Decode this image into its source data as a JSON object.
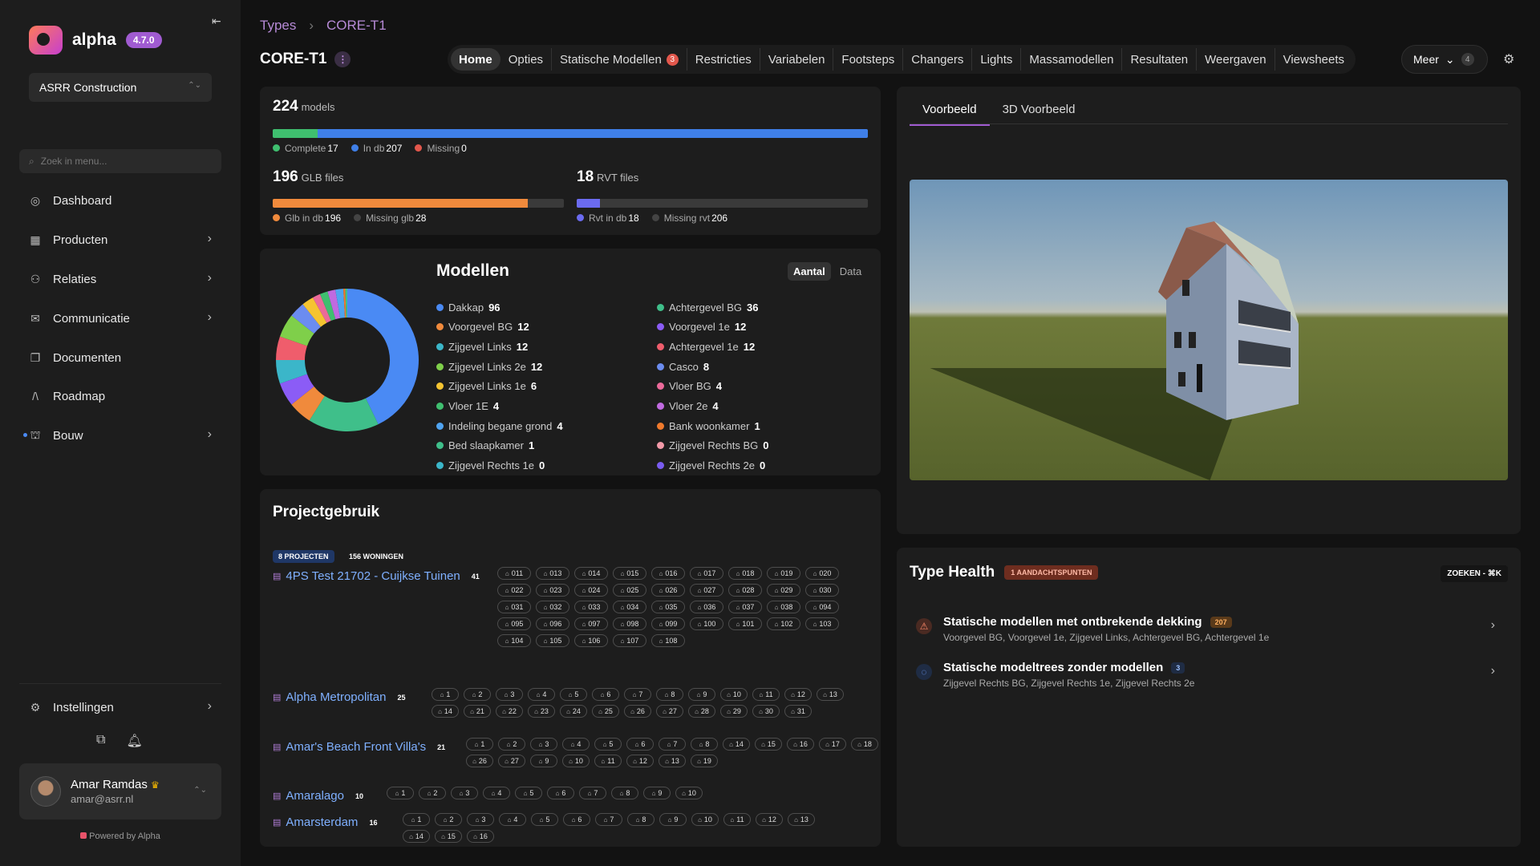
{
  "app": {
    "name": "alpha",
    "version": "4.7.0",
    "org": "ASRR Construction",
    "search_placeholder": "Zoek in menu...",
    "powered_by": "Powered by Alpha"
  },
  "nav": {
    "items": [
      {
        "label": "Dashboard",
        "icon": "dashboard-icon"
      },
      {
        "label": "Producten",
        "icon": "grid-icon"
      },
      {
        "label": "Relaties",
        "icon": "users-icon"
      },
      {
        "label": "Communicatie",
        "icon": "mail-icon"
      },
      {
        "label": "Documenten",
        "icon": "documents-icon"
      },
      {
        "label": "Roadmap",
        "icon": "roadmap-icon"
      },
      {
        "label": "Bouw",
        "icon": "crane-icon"
      }
    ],
    "settings": "Instellingen"
  },
  "user": {
    "name": "Amar Ramdas",
    "email": "amar@asrr.nl"
  },
  "breadcrumb": [
    "Types",
    "CORE-T1"
  ],
  "page_title": "CORE-T1",
  "tabs": [
    {
      "label": "Home",
      "active": true
    },
    {
      "label": "Opties"
    },
    {
      "label": "Statische Modellen",
      "badge": "3"
    },
    {
      "label": "Restricties"
    },
    {
      "label": "Variabelen"
    },
    {
      "label": "Footsteps"
    },
    {
      "label": "Changers"
    },
    {
      "label": "Lights"
    },
    {
      "label": "Massamodellen"
    },
    {
      "label": "Resultaten"
    },
    {
      "label": "Weergaven"
    },
    {
      "label": "Viewsheets"
    }
  ],
  "more": {
    "label": "Meer",
    "count": "4"
  },
  "stats": {
    "models": {
      "count": "224",
      "unit": "models",
      "complete_label": "Complete",
      "complete": 17,
      "in_db_label": "In db",
      "in_db": 207,
      "missing_label": "Missing",
      "missing": 0
    },
    "glb": {
      "count": "196",
      "unit": "GLB files",
      "in_db_label": "Glb in db",
      "in_db": 196,
      "missing_label": "Missing glb",
      "missing": 28
    },
    "rvt": {
      "count": "18",
      "unit": "RVT files",
      "in_db_label": "Rvt in db",
      "in_db": 18,
      "missing_label": "Missing rvt",
      "missing": 206
    }
  },
  "modellen": {
    "title": "Modellen",
    "toggle": [
      "Aantal",
      "Data"
    ],
    "items": [
      {
        "label": "Dakkap",
        "value": 96,
        "color": "#4a8af4"
      },
      {
        "label": "Achtergevel BG",
        "value": 36,
        "color": "#3fbf8a"
      },
      {
        "label": "Voorgevel BG",
        "value": 12,
        "color": "#f08a3c"
      },
      {
        "label": "Voorgevel 1e",
        "value": 12,
        "color": "#8b5cf6"
      },
      {
        "label": "Zijgevel Links",
        "value": 12,
        "color": "#3bb6c9"
      },
      {
        "label": "Achtergevel 1e",
        "value": 12,
        "color": "#ef5d6c"
      },
      {
        "label": "Zijgevel Links 2e",
        "value": 12,
        "color": "#7fcf4a"
      },
      {
        "label": "Casco",
        "value": 8,
        "color": "#6b8cf0"
      },
      {
        "label": "Zijgevel Links 1e",
        "value": 6,
        "color": "#f5c431"
      },
      {
        "label": "Vloer BG",
        "value": 4,
        "color": "#ec6a9a"
      },
      {
        "label": "Vloer 1E",
        "value": 4,
        "color": "#3fbf6f"
      },
      {
        "label": "Vloer 2e",
        "value": 4,
        "color": "#c06ae0"
      },
      {
        "label": "Indeling begane grond",
        "value": 4,
        "color": "#4fa3f0"
      },
      {
        "label": "Bank woonkamer",
        "value": 1,
        "color": "#f07a2c"
      },
      {
        "label": "Bed slaapkamer",
        "value": 1,
        "color": "#3fbf8a"
      },
      {
        "label": "Zijgevel Rechts BG",
        "value": 0,
        "color": "#f39aa8"
      },
      {
        "label": "Zijgevel Rechts 1e",
        "value": 0,
        "color": "#3bb6c9"
      },
      {
        "label": "Zijgevel Rechts 2e",
        "value": 0,
        "color": "#7a5cf0"
      }
    ]
  },
  "project": {
    "title": "Projectgebruik",
    "chip_projects": "8 PROJECTEN",
    "chip_homes": "156 WONINGEN",
    "rows": [
      {
        "name": "4PS Test 21702 - Cuijkse Tuinen",
        "count": "41",
        "units": [
          "011",
          "013",
          "014",
          "015",
          "016",
          "017",
          "018",
          "019",
          "020",
          "022",
          "023",
          "024",
          "025",
          "026",
          "027",
          "028",
          "029",
          "030",
          "031",
          "032",
          "033",
          "034",
          "035",
          "036",
          "037",
          "038",
          "094",
          "095",
          "096",
          "097",
          "098",
          "099",
          "100",
          "101",
          "102",
          "103",
          "104",
          "105",
          "106",
          "107",
          "108"
        ]
      },
      {
        "name": "Alpha Metropolitan",
        "count": "25",
        "units": [
          "1",
          "2",
          "3",
          "4",
          "5",
          "6",
          "7",
          "8",
          "9",
          "10",
          "11",
          "12",
          "13",
          "14",
          "21",
          "22",
          "23",
          "24",
          "25",
          "26",
          "27",
          "28",
          "29",
          "30",
          "31"
        ]
      },
      {
        "name": "Amar's Beach Front Villa's",
        "count": "21",
        "units": [
          "1",
          "2",
          "3",
          "4",
          "5",
          "6",
          "7",
          "8",
          "14",
          "15",
          "16",
          "17",
          "18",
          "26",
          "27",
          "9",
          "10",
          "11",
          "12",
          "13",
          "19"
        ]
      },
      {
        "name": "Amaralago",
        "count": "10",
        "units": [
          "1",
          "2",
          "3",
          "4",
          "5",
          "6",
          "7",
          "8",
          "9",
          "10"
        ]
      },
      {
        "name": "Amarsterdam",
        "count": "16",
        "units": [
          "1",
          "2",
          "3",
          "4",
          "5",
          "6",
          "7",
          "8",
          "9",
          "10",
          "11",
          "12",
          "13",
          "14",
          "15",
          "16"
        ]
      }
    ]
  },
  "preview": {
    "tabs": [
      "Voorbeeld",
      "3D Voorbeeld"
    ]
  },
  "health": {
    "title": "Type Health",
    "badge": "1 AANDACHTSPUNTEN",
    "search": "ZOEKEN - ⌘K",
    "items": [
      {
        "title": "Statische modellen met ontbrekende dekking",
        "count": "207",
        "sub": "Voorgevel BG, Voorgevel 1e, Zijgevel Links, Achtergevel BG, Achtergevel 1e"
      },
      {
        "title": "Statische modeltrees zonder modellen",
        "count": "3",
        "sub": "Zijgevel Rechts BG, Zijgevel Rechts 1e, Zijgevel Rechts 2e"
      }
    ]
  }
}
